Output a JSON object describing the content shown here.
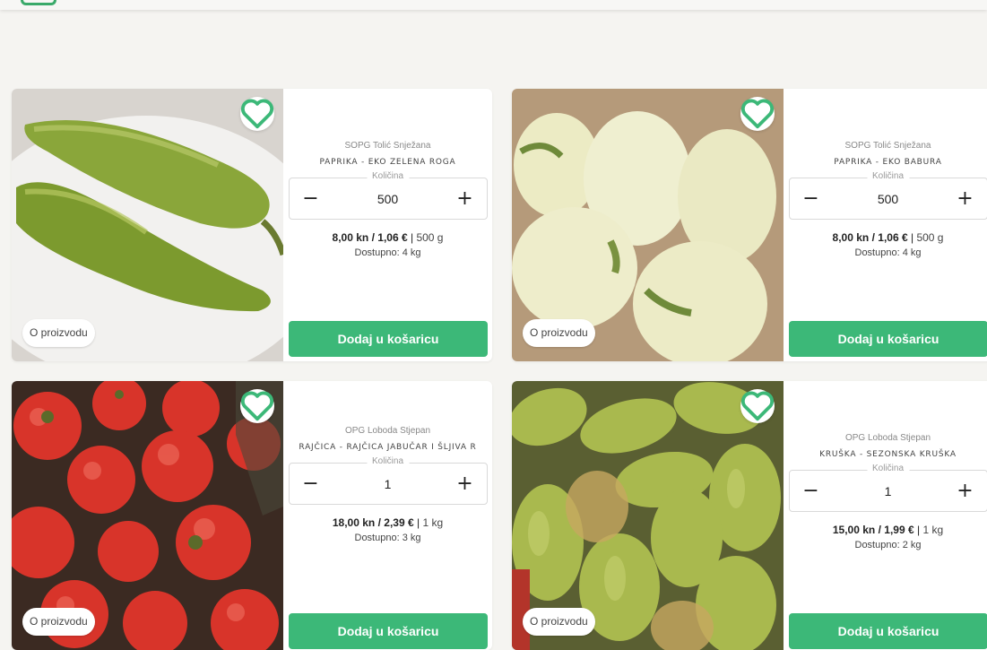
{
  "ui": {
    "quantity_label": "Količina",
    "add_to_cart_label": "Dodaj u košaricu",
    "about_label": "O proizvodu",
    "accent_color": "#3cb878"
  },
  "products": [
    {
      "seller": "SOPG Tolić Snježana",
      "name": "PAPRIKA - EKO ZELENA ROGA",
      "quantity": "500",
      "price_kn": "8,00 kn",
      "price_eur": "1,06 €",
      "unit": "500 g",
      "available": "Dostupno: 4 kg",
      "image": "green-peppers"
    },
    {
      "seller": "SOPG Tolić Snježana",
      "name": "PAPRIKA - EKO BABURA",
      "quantity": "500",
      "price_kn": "8,00 kn",
      "price_eur": "1,06 €",
      "unit": "500 g",
      "available": "Dostupno: 4 kg",
      "image": "white-bell-peppers"
    },
    {
      "seller": "OPG Loboda Stjepan",
      "name": "RAJČICA - RAJČICA JABUČAR I ŠLJIVA R",
      "quantity": "1",
      "price_kn": "18,00 kn",
      "price_eur": "2,39 €",
      "unit": "1 kg",
      "available": "Dostupno: 3 kg",
      "image": "tomatoes"
    },
    {
      "seller": "OPG Loboda Stjepan",
      "name": "KRUŠKA - SEZONSKA KRUŠKA",
      "quantity": "1",
      "price_kn": "15,00 kn",
      "price_eur": "1,99 €",
      "unit": "1 kg",
      "available": "Dostupno: 2 kg",
      "image": "pears"
    }
  ]
}
